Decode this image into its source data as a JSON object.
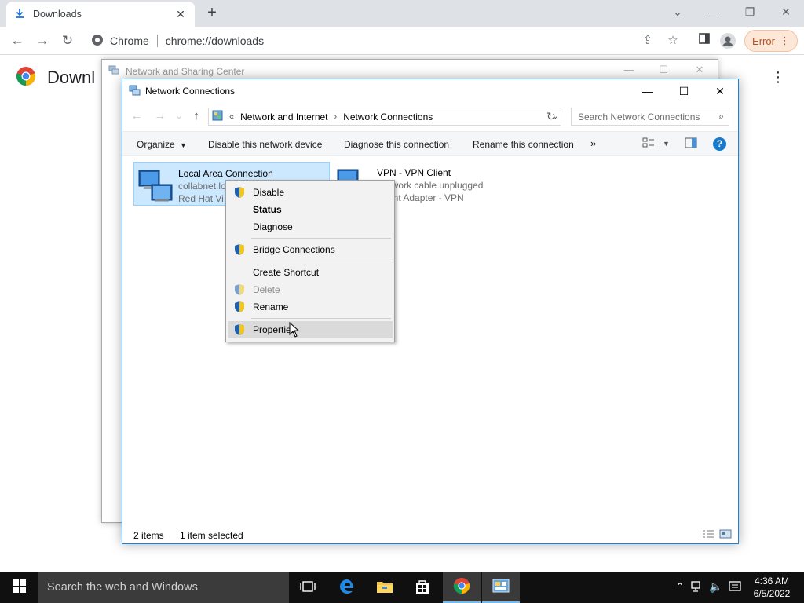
{
  "chrome": {
    "tab_title": "Downloads",
    "tab_close": "✕",
    "new_tab": "+",
    "site_chip": "Chrome",
    "url": "chrome://downloads",
    "error_label": "Error",
    "page_title": "Downloads",
    "page_title_visible": "Downl"
  },
  "nsc": {
    "title": "Network and Sharing Center"
  },
  "nc": {
    "title": "Network Connections",
    "breadcrumb": [
      "Network and Internet",
      "Network Connections"
    ],
    "breadcrumb_prefix": "«",
    "search_placeholder": "Search Network Connections",
    "commands": {
      "organize": "Organize",
      "disable": "Disable this network device",
      "diagnose": "Diagnose this connection",
      "rename": "Rename this connection",
      "more": "»"
    },
    "connections": [
      {
        "name": "Local Area Connection",
        "line2": "collabnet.lo",
        "line3": "Red Hat Vi"
      },
      {
        "name": "VPN - VPN Client",
        "line2": "Network cable unplugged",
        "line3": "Client Adapter - VPN"
      }
    ],
    "status": {
      "items": "2 items",
      "selected": "1 item selected"
    }
  },
  "context_menu": {
    "items": [
      {
        "label": "Disable"
      },
      {
        "label": "Status"
      },
      {
        "label": "Diagnose"
      },
      {
        "label": "Bridge Connections"
      },
      {
        "label": "Create Shortcut"
      },
      {
        "label": "Delete"
      },
      {
        "label": "Rename"
      },
      {
        "label": "Properties"
      }
    ]
  },
  "taskbar": {
    "search_placeholder": "Search the web and Windows",
    "time": "4:36 AM",
    "date": "6/5/2022"
  },
  "colors": {
    "accent": "#1883d7",
    "selection": "#cce8ff",
    "error_text": "#b3541e",
    "taskbar": "#101010"
  }
}
